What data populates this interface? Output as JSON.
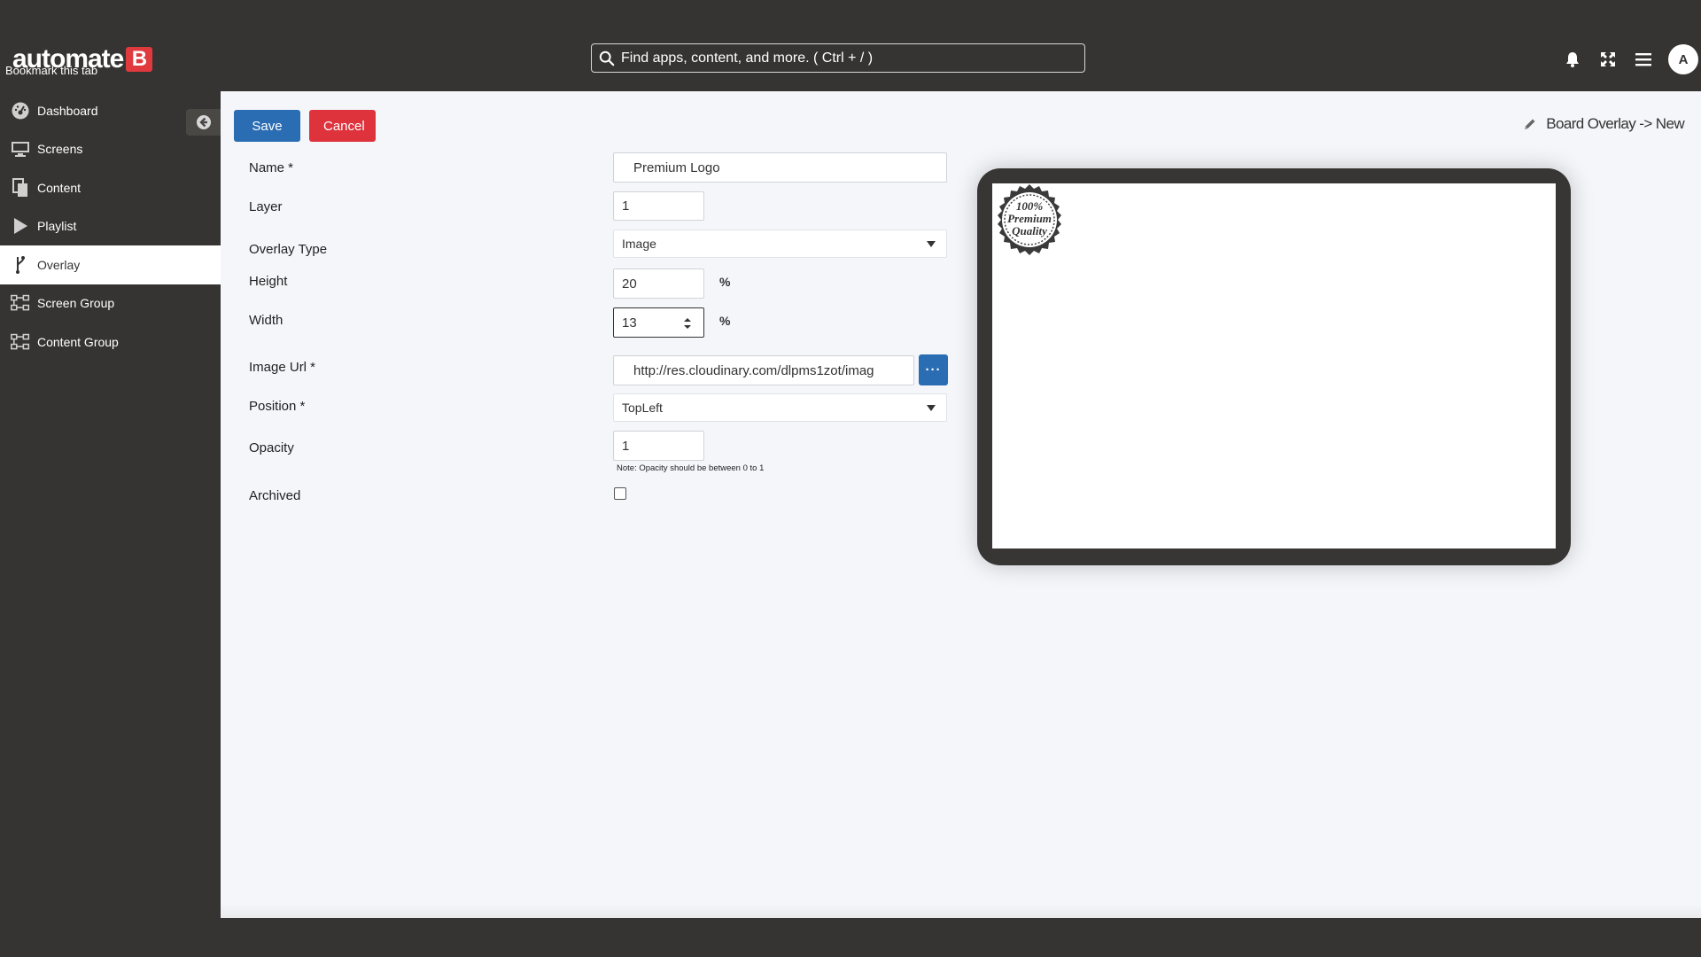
{
  "app": {
    "logo_text": "automate",
    "logo_mark": "B",
    "bookmark_label": "Bookmark this tab"
  },
  "search": {
    "placeholder": "Find apps, content, and more. ( Ctrl + / )"
  },
  "topbar_icons": [
    "bell-icon",
    "expand-icon",
    "hamburger-icon"
  ],
  "user": {
    "avatar_initial": "A"
  },
  "sidebar": {
    "items": [
      {
        "label": "Dashboard",
        "icon": "dashboard-icon"
      },
      {
        "label": "Screens",
        "icon": "monitor-icon"
      },
      {
        "label": "Content",
        "icon": "content-icon"
      },
      {
        "label": "Playlist",
        "icon": "play-icon"
      },
      {
        "label": "Overlay",
        "icon": "overlay-icon",
        "active": true
      },
      {
        "label": "Screen Group",
        "icon": "screen-group-icon"
      },
      {
        "label": "Content Group",
        "icon": "content-group-icon"
      }
    ]
  },
  "toolbar": {
    "save_label": "Save",
    "cancel_label": "Cancel"
  },
  "breadcrumb": {
    "text": "Board Overlay -> New"
  },
  "form": {
    "name": {
      "label": "Name *",
      "value": "Premium Logo"
    },
    "layer": {
      "label": "Layer",
      "value": "1"
    },
    "overlay_type": {
      "label": "Overlay Type",
      "value": "Image"
    },
    "height": {
      "label": "Height",
      "value": "20",
      "unit": "%"
    },
    "width": {
      "label": "Width",
      "value": "13",
      "unit": "%"
    },
    "image_url": {
      "label": "Image Url *",
      "value": "http://res.cloudinary.com/dlpms1zot/imag",
      "more_label": "···"
    },
    "position": {
      "label": "Position *",
      "value": "TopLeft"
    },
    "opacity": {
      "label": "Opacity",
      "value": "1",
      "note": "Note: Opacity should be between 0 to 1"
    },
    "archived": {
      "label": "Archived",
      "checked": false
    }
  },
  "preview": {
    "badge_line1": "100%",
    "badge_line2": "Premium",
    "badge_line3": "Quality"
  },
  "colors": {
    "topbar_bg": "#363432",
    "primary": "#2a6db3",
    "danger": "#de333c",
    "brand_red": "#e0393e",
    "main_bg": "#f4f6fa"
  }
}
